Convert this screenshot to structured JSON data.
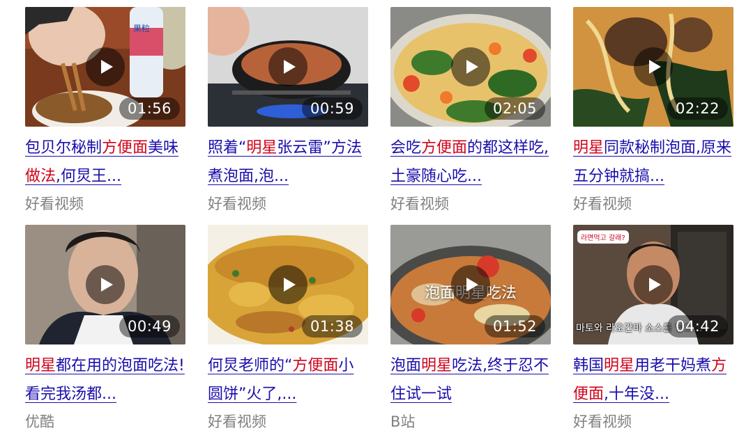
{
  "colors": {
    "link": "#1a0dab",
    "highlight": "#d0021b",
    "source": "#808080"
  },
  "icons": {
    "play": "play-icon"
  },
  "videos": [
    {
      "duration": "01:56",
      "title_parts": [
        {
          "text": "包贝尔秘制",
          "hl": false
        },
        {
          "text": "方便面",
          "hl": true
        },
        {
          "text": "美味",
          "hl": false
        },
        {
          "text": "做法",
          "hl": true
        },
        {
          "text": ",何炅王...",
          "hl": false
        }
      ],
      "source": "好看视频",
      "thumb_note": "thumbnail-bottle-label",
      "thumb_text": "果粒"
    },
    {
      "duration": "00:59",
      "title_parts": [
        {
          "text": "照着“",
          "hl": false
        },
        {
          "text": "明星",
          "hl": true
        },
        {
          "text": "张云雷”方法煮泡面,泡...",
          "hl": false
        }
      ],
      "source": "好看视频"
    },
    {
      "duration": "02:05",
      "title_parts": [
        {
          "text": "会吃",
          "hl": false
        },
        {
          "text": "方便面",
          "hl": true
        },
        {
          "text": "的都这样吃,土豪随心吃...",
          "hl": false
        }
      ],
      "source": "好看视频"
    },
    {
      "duration": "02:22",
      "title_parts": [
        {
          "text": "明星",
          "hl": true
        },
        {
          "text": "同款秘制泡面,原来五分钟就搞...",
          "hl": false
        }
      ],
      "source": "好看视频"
    },
    {
      "duration": "00:49",
      "title_parts": [
        {
          "text": "明星",
          "hl": true
        },
        {
          "text": "都在用的泡面吃法!看完我汤都...",
          "hl": false
        }
      ],
      "source": "优酷"
    },
    {
      "duration": "01:38",
      "title_parts": [
        {
          "text": "何炅老师的“",
          "hl": false
        },
        {
          "text": "方便面",
          "hl": true
        },
        {
          "text": "小圆饼”火了,...",
          "hl": false
        }
      ],
      "source": "好看视频"
    },
    {
      "duration": "01:52",
      "title_parts": [
        {
          "text": "泡面",
          "hl": false
        },
        {
          "text": "明星",
          "hl": true
        },
        {
          "text": "吃法,终于忍不住试一试",
          "hl": false
        }
      ],
      "source": "B站",
      "thumb_caption": "泡面明星吃法"
    },
    {
      "duration": "04:42",
      "title_parts": [
        {
          "text": "韩国",
          "hl": false
        },
        {
          "text": "明星",
          "hl": true
        },
        {
          "text": "用老干妈煮",
          "hl": false
        },
        {
          "text": "方便面",
          "hl": true
        },
        {
          "text": ",十年没...",
          "hl": false
        }
      ],
      "source": "好看视频",
      "thumb_badge": "라면먹고 갈래?",
      "thumb_subtitle": "마토와 라오간마 소스를 넣으..."
    }
  ]
}
